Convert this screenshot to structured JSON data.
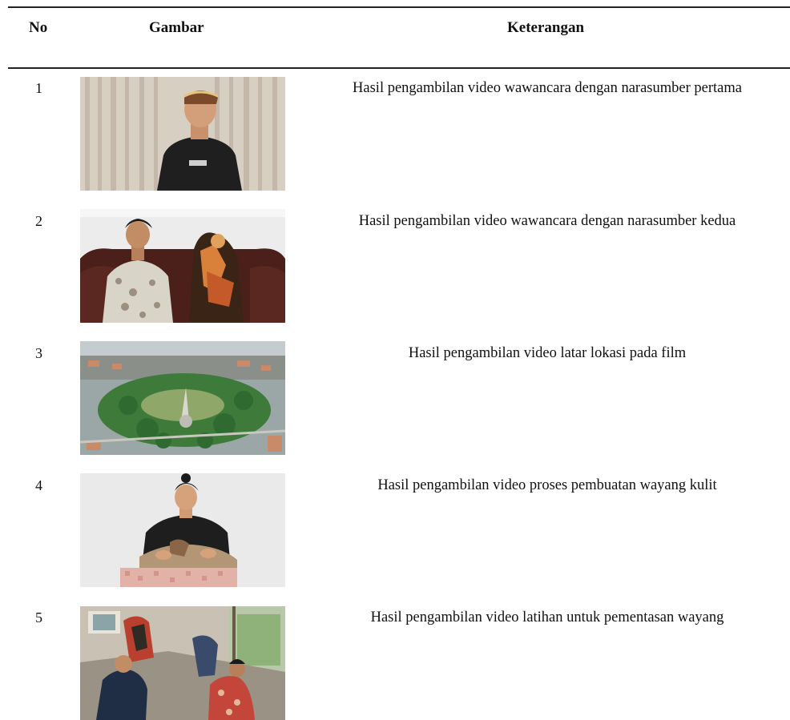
{
  "table": {
    "headers": {
      "no": "No",
      "gambar": "Gambar",
      "keterangan": "Keterangan"
    },
    "rows": [
      {
        "no": "1",
        "image": "interview-first-source-photo",
        "keterangan": "Hasil pengambilan video wawancara dengan narasumber pertama"
      },
      {
        "no": "2",
        "image": "interview-second-source-photo",
        "keterangan": "Hasil pengambilan video wawancara dengan narasumber kedua"
      },
      {
        "no": "3",
        "image": "aerial-location-photo",
        "keterangan": "Hasil pengambilan video latar lokasi pada film"
      },
      {
        "no": "4",
        "image": "wayang-making-photo",
        "keterangan": "Hasil pengambilan video proses pembuatan wayang kulit"
      },
      {
        "no": "5",
        "image": "wayang-rehearsal-photo",
        "keterangan": "Hasil pengambilan video latihan untuk pementasan wayang"
      }
    ]
  }
}
